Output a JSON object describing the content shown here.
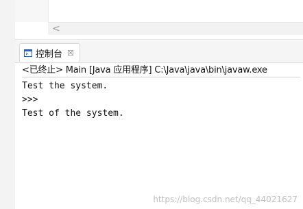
{
  "editor": {
    "scroll_left_arrow": "<"
  },
  "console_view": {
    "tab_label": "控制台",
    "tab_icon": "console-icon",
    "close_glyph": "☒",
    "status_line": "<已终止> Main [Java 应用程序] C:\\Java\\java\\bin\\javaw.exe",
    "output_lines": [
      "Test the system.",
      ">>>",
      "Test of the system."
    ]
  },
  "watermark": "https://blog.csdn.net/qq_44021627",
  "colors": {
    "background": "#ffffff",
    "tab_bar": "#f5f5f5",
    "text": "#111111",
    "icon_blue": "#2a5fa8"
  }
}
